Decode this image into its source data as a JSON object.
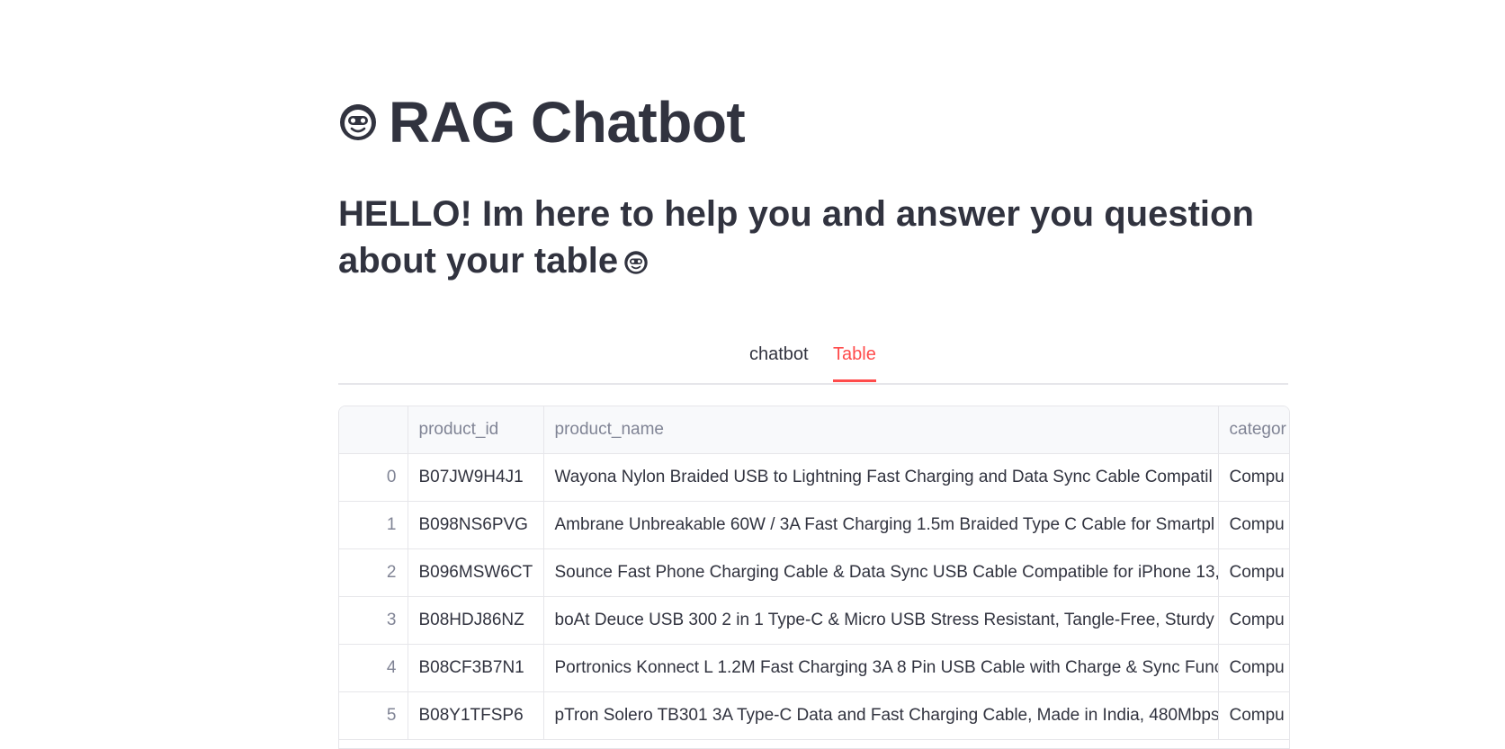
{
  "app": {
    "title": "RAG Chatbot",
    "title_emoji": "robot-face-icon",
    "subtitle": "HELLO! Im here to help you and answer you question about your table"
  },
  "tabs": [
    {
      "label": "chatbot",
      "active": false
    },
    {
      "label": "Table",
      "active": true
    }
  ],
  "colors": {
    "accent": "#ff4b4b",
    "text": "#31333f",
    "muted": "#808495",
    "border": "#e6e6ea"
  },
  "table": {
    "columns": [
      "",
      "product_id",
      "product_name",
      "categor"
    ],
    "rows": [
      {
        "index": "0",
        "product_id": "B07JW9H4J1",
        "product_name": "Wayona Nylon Braided USB to Lightning Fast Charging and Data Sync Cable Compatil",
        "category": "Compu"
      },
      {
        "index": "1",
        "product_id": "B098NS6PVG",
        "product_name": "Ambrane Unbreakable 60W / 3A Fast Charging 1.5m Braided Type C Cable for Smartpl",
        "category": "Compu"
      },
      {
        "index": "2",
        "product_id": "B096MSW6CT",
        "product_name": "Sounce Fast Phone Charging Cable & Data Sync USB Cable Compatible for iPhone 13,",
        "category": "Compu"
      },
      {
        "index": "3",
        "product_id": "B08HDJ86NZ",
        "product_name": "boAt Deuce USB 300 2 in 1 Type-C & Micro USB Stress Resistant, Tangle-Free, Sturdy C",
        "category": "Compu"
      },
      {
        "index": "4",
        "product_id": "B08CF3B7N1",
        "product_name": "Portronics Konnect L 1.2M Fast Charging 3A 8 Pin USB Cable with Charge & Sync Func",
        "category": "Compu"
      },
      {
        "index": "5",
        "product_id": "B08Y1TFSP6",
        "product_name": "pTron Solero TB301 3A Type-C Data and Fast Charging Cable, Made in India, 480Mbps",
        "category": "Compu"
      }
    ]
  }
}
